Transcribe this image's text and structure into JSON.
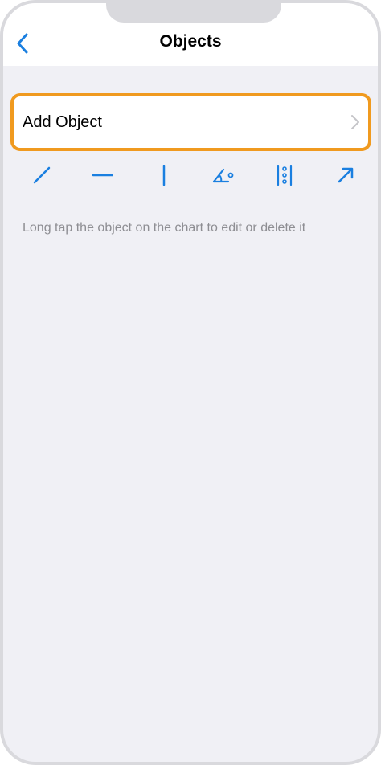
{
  "nav": {
    "title": "Objects",
    "back_icon": "chevron-left-icon"
  },
  "add_object": {
    "label": "Add Object",
    "chevron_icon": "chevron-right-icon"
  },
  "tools": [
    {
      "name": "trendline-icon"
    },
    {
      "name": "horizontal-line-icon"
    },
    {
      "name": "vertical-line-icon"
    },
    {
      "name": "angle-icon"
    },
    {
      "name": "equidistant-channel-icon"
    },
    {
      "name": "arrow-icon"
    }
  ],
  "hint": "Long tap the object on the chart to edit or delete it",
  "colors": {
    "accent": "#1a7fe0",
    "highlight": "#f09a1f",
    "background": "#f0f0f5",
    "secondary_text": "#8e8e93"
  }
}
